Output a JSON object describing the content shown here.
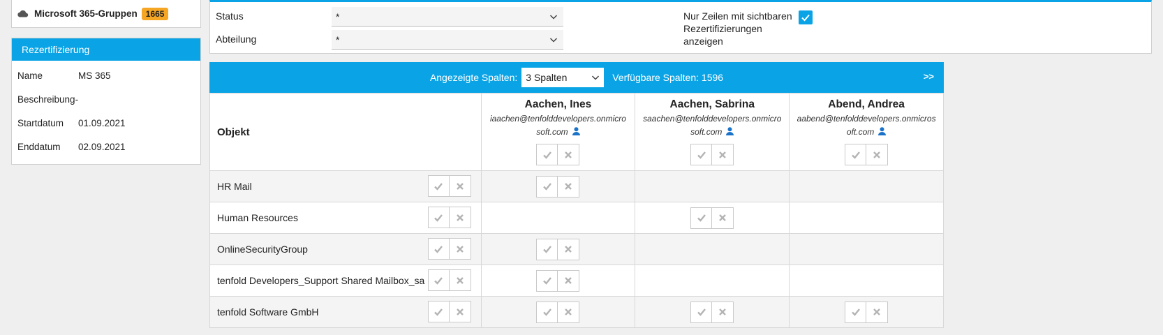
{
  "group": {
    "title": "Microsoft 365-Gruppen",
    "count": "1665",
    "badge_color": "#f5a623"
  },
  "recert": {
    "header": "Rezertifizierung",
    "fields": [
      {
        "label": "Name",
        "value": "MS 365"
      },
      {
        "label": "Beschreibung",
        "value": "-"
      },
      {
        "label": "Startdatum",
        "value": "01.09.2021"
      },
      {
        "label": "Enddatum",
        "value": "02.09.2021"
      }
    ]
  },
  "filters": {
    "status_label": "Status",
    "status_value": "*",
    "abteilung_label": "Abteilung",
    "abteilung_value": "*",
    "checkbox_label": "Nur Zeilen mit sichtbaren Rezertifizierungen anzeigen",
    "checkbox_checked": true
  },
  "grid": {
    "shown_columns_label": "Angezeigte Spalten:",
    "shown_columns_value": "3 Spalten",
    "available_columns": "Verfügbare Spalten: 1596",
    "next_label": ">>",
    "object_header": "Objekt",
    "users": [
      {
        "name": "Aachen, Ines",
        "email_line1": "iaachen@tenfolddevelopers.onmicro",
        "email_line2": "soft.com"
      },
      {
        "name": "Aachen, Sabrina",
        "email_line1": "saachen@tenfolddevelopers.onmicro",
        "email_line2": "soft.com"
      },
      {
        "name": "Abend, Andrea",
        "email_line1": "aabend@tenfolddevelopers.onmicros",
        "email_line2": "oft.com"
      }
    ],
    "rows": [
      {
        "object": "HR Mail",
        "cells": [
          true,
          false,
          false
        ]
      },
      {
        "object": "Human Resources",
        "cells": [
          false,
          true,
          false
        ]
      },
      {
        "object": "OnlineSecurityGroup",
        "cells": [
          true,
          false,
          false
        ]
      },
      {
        "object": "tenfold Developers_Support Shared Mailbox_sa",
        "cells": [
          true,
          false,
          false
        ]
      },
      {
        "object": "tenfold Software GmbH",
        "cells": [
          true,
          true,
          true
        ]
      }
    ]
  },
  "colors": {
    "accent": "#0aa4e6",
    "icon_blue": "#1a73c9"
  }
}
